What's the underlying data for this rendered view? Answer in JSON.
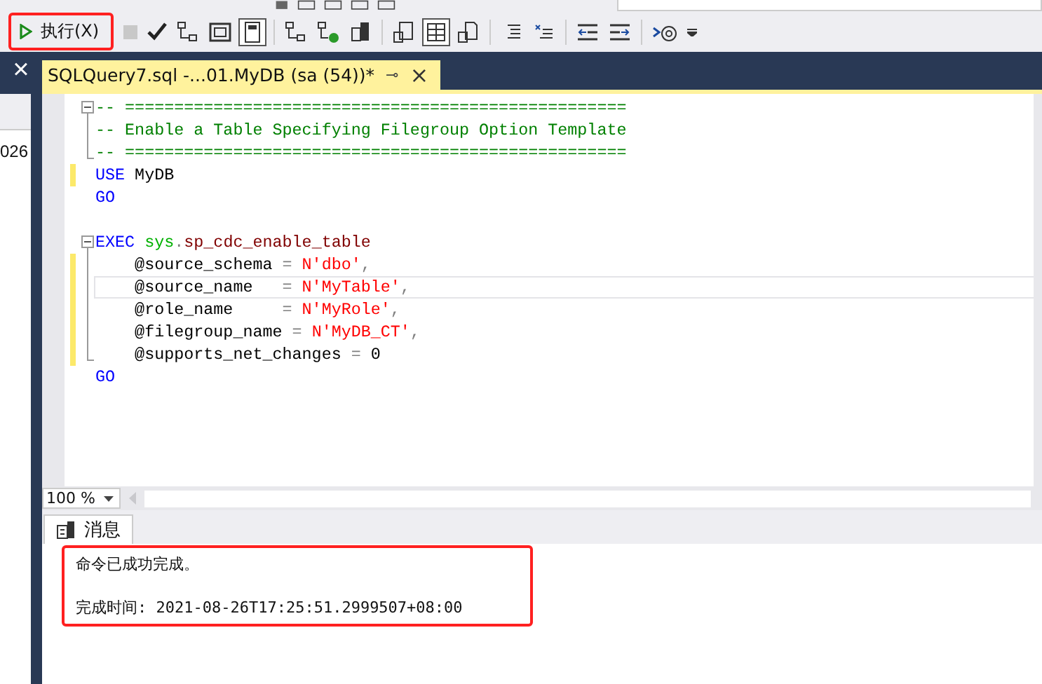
{
  "toolbar": {
    "execute_button": {
      "label": "执行(X)",
      "highlighted": true
    }
  },
  "left_panel": {
    "close_button": "×",
    "text": "026"
  },
  "tabs": [
    {
      "label": "SQLQuery7.sql -...01.MyDB (sa (54))*",
      "selected": true,
      "pin": "⊸",
      "close": "×"
    }
  ],
  "editor": {
    "lines": [
      {
        "collapsible": true,
        "block_end": false,
        "changed": false,
        "current": false,
        "tokens": [
          {
            "kind": "comment",
            "text": "-- ==================================================="
          }
        ]
      },
      {
        "collapsible": false,
        "block_end": false,
        "changed": false,
        "current": false,
        "tokens": [
          {
            "kind": "comment",
            "text": "-- Enable a Table Specifying Filegroup Option Template"
          }
        ]
      },
      {
        "collapsible": false,
        "block_end": true,
        "changed": false,
        "current": false,
        "tokens": [
          {
            "kind": "comment",
            "text": "-- ==================================================="
          }
        ]
      },
      {
        "collapsible": false,
        "block_end": false,
        "changed": true,
        "current": false,
        "tokens": [
          {
            "kind": "keyword",
            "text": "USE"
          },
          {
            "kind": "plain",
            "text": " MyDB"
          }
        ]
      },
      {
        "collapsible": false,
        "block_end": false,
        "changed": false,
        "current": false,
        "tokens": [
          {
            "kind": "keyword",
            "text": "GO"
          }
        ]
      },
      {
        "collapsible": false,
        "block_end": false,
        "changed": false,
        "current": false
      },
      {
        "collapsible": true,
        "block_end": false,
        "changed": false,
        "current": false,
        "tokens": [
          {
            "kind": "keyword",
            "text": "EXEC"
          },
          {
            "kind": "system",
            "text": " sys"
          },
          {
            "kind": "operator",
            "text": "."
          },
          {
            "kind": "proc",
            "text": "sp_cdc_enable_table"
          }
        ]
      },
      {
        "collapsible": false,
        "block_end": false,
        "changed": true,
        "current": false,
        "tokens": [
          {
            "kind": "plain",
            "text": "    @source_schema "
          },
          {
            "kind": "operator",
            "text": "= "
          },
          {
            "kind": "string",
            "text": "N'dbo'"
          },
          {
            "kind": "operator",
            "text": ","
          }
        ]
      },
      {
        "collapsible": false,
        "block_end": false,
        "changed": true,
        "current": true,
        "tokens": [
          {
            "kind": "plain",
            "text": "    @source_name   "
          },
          {
            "kind": "operator",
            "text": "= "
          },
          {
            "kind": "string",
            "text": "N'MyTable'"
          },
          {
            "kind": "operator",
            "text": ","
          }
        ]
      },
      {
        "collapsible": false,
        "block_end": false,
        "changed": true,
        "current": false,
        "tokens": [
          {
            "kind": "plain",
            "text": "    @role_name     "
          },
          {
            "kind": "operator",
            "text": "= "
          },
          {
            "kind": "string",
            "text": "N'MyRole'"
          },
          {
            "kind": "operator",
            "text": ","
          }
        ]
      },
      {
        "collapsible": false,
        "block_end": false,
        "changed": true,
        "current": false,
        "tokens": [
          {
            "kind": "plain",
            "text": "    @filegroup_name "
          },
          {
            "kind": "operator",
            "text": "= "
          },
          {
            "kind": "string",
            "text": "N'MyDB_CT'"
          },
          {
            "kind": "operator",
            "text": ","
          }
        ]
      },
      {
        "collapsible": false,
        "block_end": true,
        "changed": true,
        "current": false,
        "tokens": [
          {
            "kind": "plain",
            "text": "    @supports_net_changes "
          },
          {
            "kind": "operator",
            "text": "= "
          },
          {
            "kind": "plain",
            "text": "0"
          }
        ]
      },
      {
        "collapsible": false,
        "block_end": false,
        "changed": false,
        "current": false,
        "tokens": [
          {
            "kind": "keyword",
            "text": "GO"
          }
        ]
      }
    ]
  },
  "zoom": {
    "value": "100 %"
  },
  "results": {
    "tabs": [
      {
        "label": "消息",
        "selected": true
      }
    ],
    "highlighted": true,
    "messages": [
      "命令已成功完成。",
      "完成时间: 2021-08-26T17:25:51.2999507+08:00"
    ]
  }
}
